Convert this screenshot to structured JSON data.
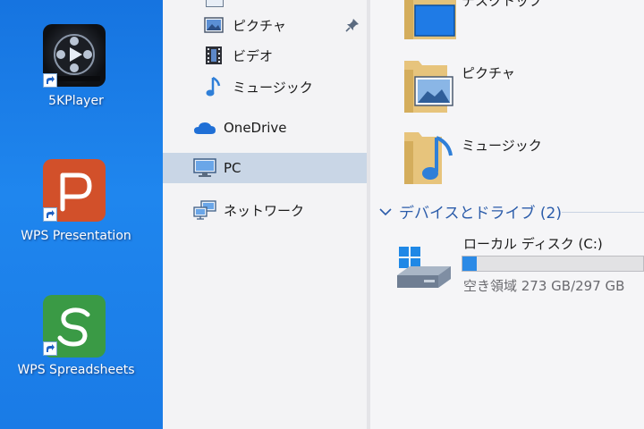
{
  "desktop": {
    "icons": [
      {
        "label": "5KPlayer",
        "icon": "5kplayer-icon"
      },
      {
        "label": "WPS Presentation",
        "icon": "wps-presentation-icon"
      },
      {
        "label": "WPS Spreadsheets",
        "icon": "wps-spreadsheets-icon"
      }
    ]
  },
  "nav": {
    "items": [
      {
        "label": "ピクチャ",
        "icon": "pictures-icon",
        "pinned": true
      },
      {
        "label": "ビデオ",
        "icon": "videos-icon"
      },
      {
        "label": "ミュージック",
        "icon": "music-icon"
      },
      {
        "label": "OneDrive",
        "icon": "onedrive-icon"
      },
      {
        "label": "PC",
        "icon": "pc-icon",
        "selected": true
      },
      {
        "label": "ネットワーク",
        "icon": "network-icon"
      }
    ]
  },
  "content": {
    "folders": [
      {
        "label": "デスクトップ",
        "icon": "desktop-folder-icon"
      },
      {
        "label": "ピクチャ",
        "icon": "pictures-folder-icon"
      },
      {
        "label": "ミュージック",
        "icon": "music-folder-icon"
      }
    ],
    "devices_header": "デバイスとドライブ (2)",
    "drive": {
      "name": "ローカル ディスク (C:)",
      "free_text": "空き領域 273 GB/297 GB",
      "used_fraction": 0.081
    }
  },
  "colors": {
    "desktop_blue": "#1a7be6",
    "selection": "#c9d6e6",
    "header_blue": "#2b5caa",
    "bar_fill": "#2b8ae6"
  }
}
